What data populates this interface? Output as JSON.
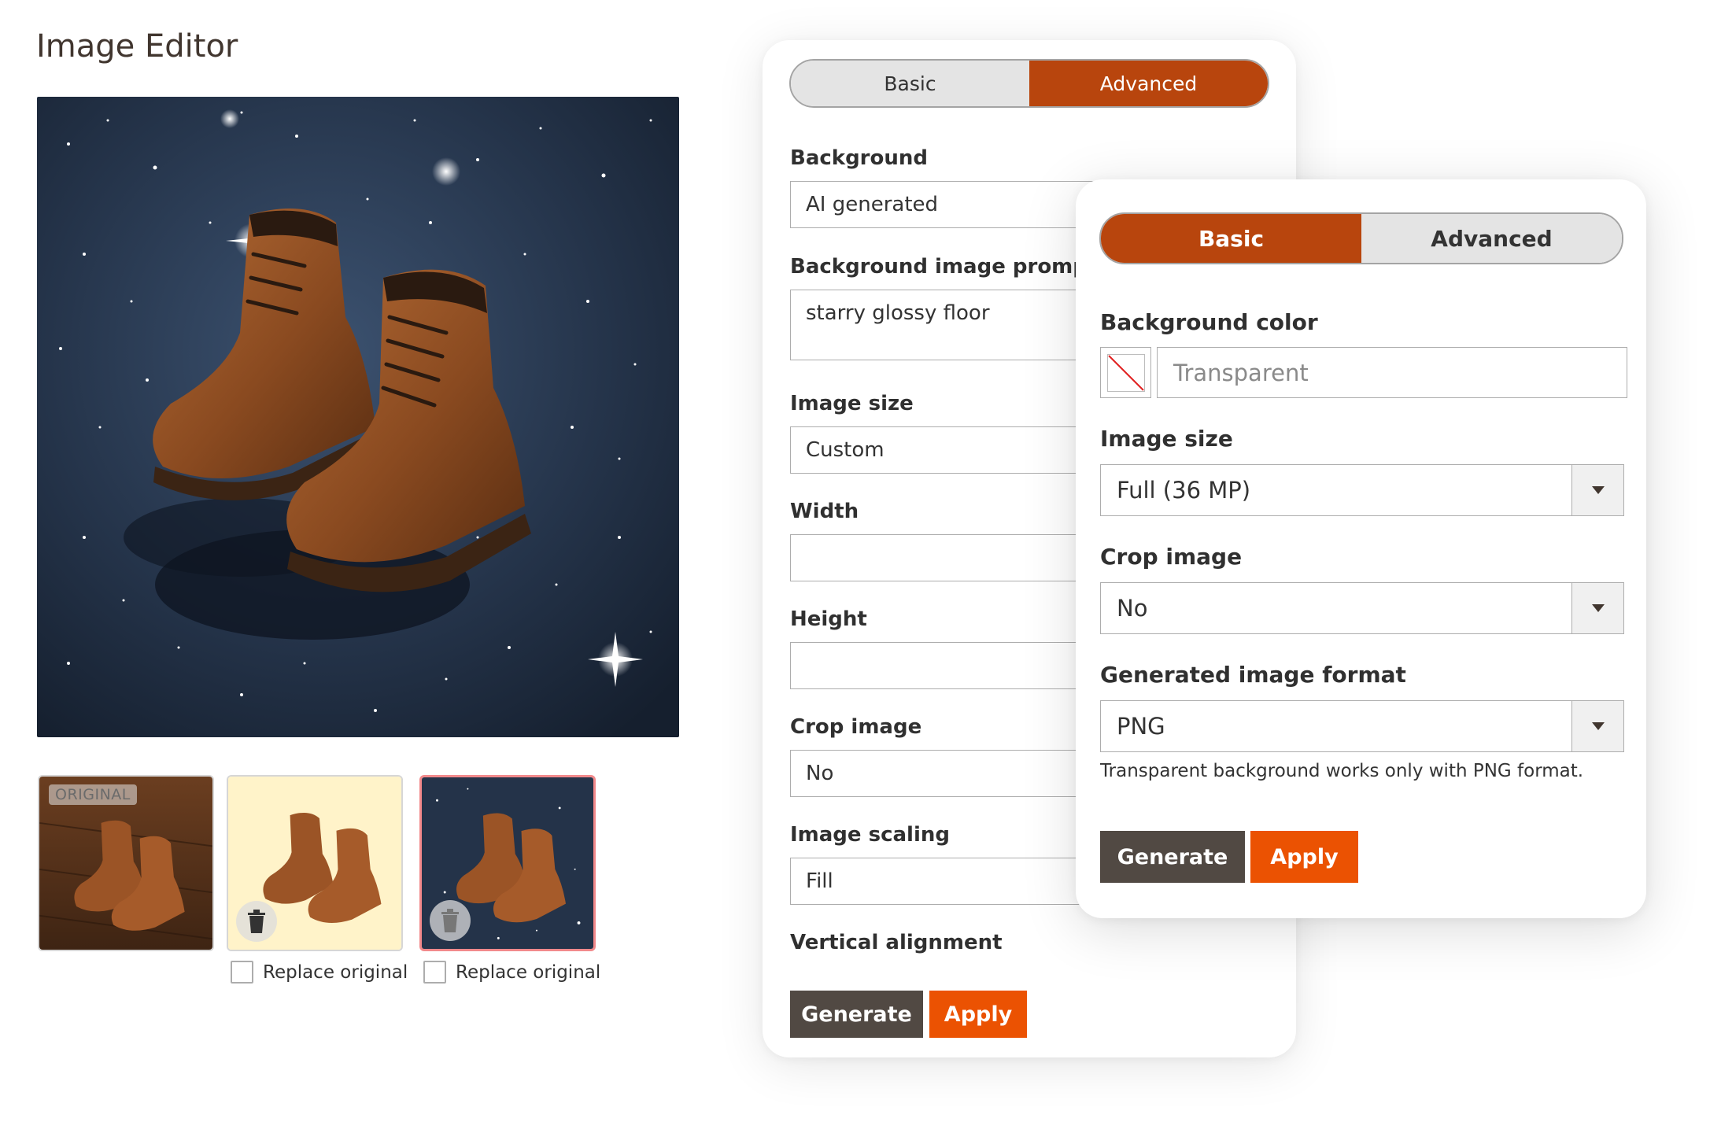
{
  "page": {
    "title": "Image Editor"
  },
  "thumbnails": {
    "original_badge": "ORIGINAL",
    "replace_label_1": "Replace original",
    "replace_label_2": "Replace original"
  },
  "advanced_panel": {
    "tabs": {
      "basic": "Basic",
      "advanced": "Advanced",
      "active": "advanced"
    },
    "background": {
      "label": "Background",
      "value": "AI generated"
    },
    "prompt": {
      "label": "Background image prompt",
      "value": "starry glossy floor"
    },
    "image_size": {
      "label": "Image size",
      "value": "Custom"
    },
    "width": {
      "label": "Width",
      "value": ""
    },
    "height": {
      "label": "Height",
      "value": ""
    },
    "crop": {
      "label": "Crop image",
      "value": "No"
    },
    "scaling": {
      "label": "Image scaling",
      "value": "Fill"
    },
    "vertical_alignment": {
      "label": "Vertical alignment"
    },
    "generate_label": "Generate",
    "apply_label": "Apply"
  },
  "basic_panel": {
    "tabs": {
      "basic": "Basic",
      "advanced": "Advanced",
      "active": "basic"
    },
    "background_color": {
      "label": "Background color",
      "placeholder": "Transparent"
    },
    "image_size": {
      "label": "Image size",
      "value": "Full (36 MP)"
    },
    "crop": {
      "label": "Crop image",
      "value": "No"
    },
    "format": {
      "label": "Generated image format",
      "value": "PNG"
    },
    "hint": "Transparent background works only with PNG format.",
    "generate_label": "Generate",
    "apply_label": "Apply"
  },
  "colors": {
    "accent_active_tab": "#b8450d",
    "apply_button": "#eb5202",
    "generate_button": "#514943"
  },
  "icons": [
    "trash-icon",
    "chevron-down-icon",
    "transparent-swatch-icon"
  ]
}
